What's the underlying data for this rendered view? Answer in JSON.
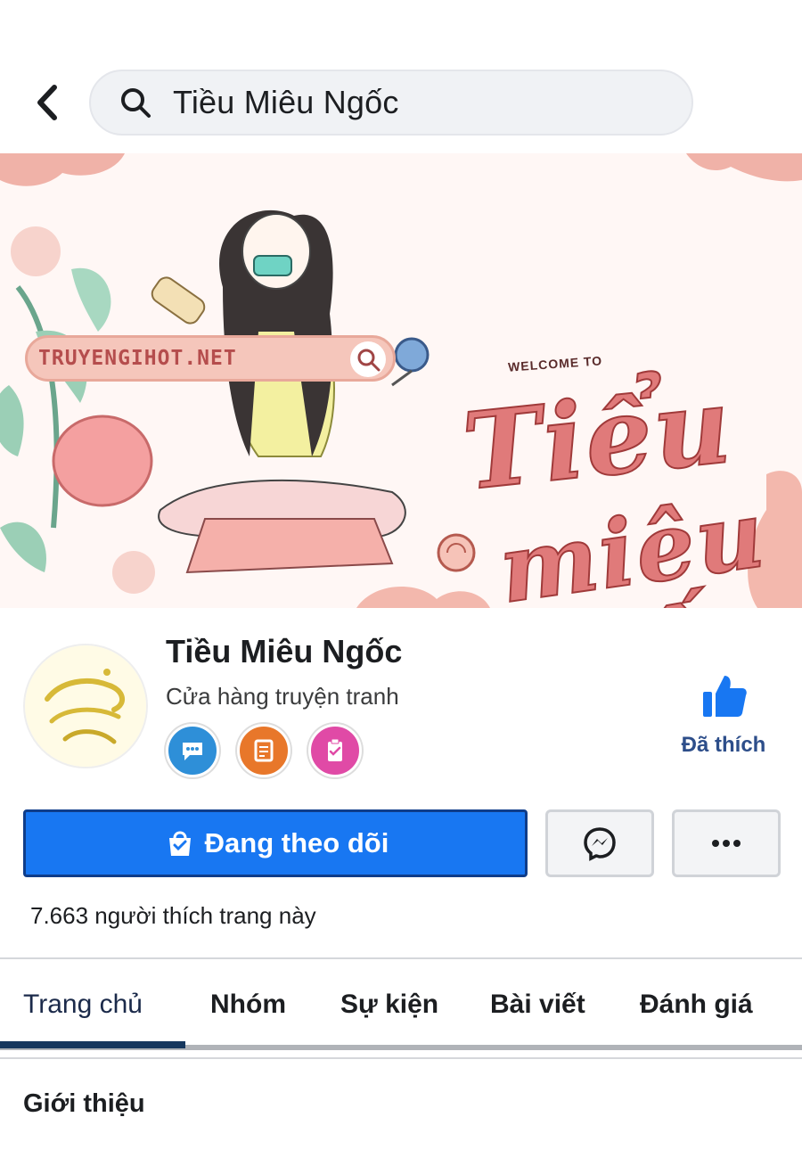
{
  "search": {
    "query": "Tiều Miêu Ngốc"
  },
  "cover": {
    "site_label": "TRUYENGIHOT.NET",
    "welcome_text": "WELCOME TO",
    "script_line1": "Tiểu",
    "script_line2": "miêu",
    "script_line3": "ngốc"
  },
  "profile": {
    "name": "Tiều Miêu Ngốc",
    "category": "Cửa hàng truyện tranh",
    "liked_label": "Đã thích",
    "badges": [
      "chat-badge-icon",
      "document-badge-icon",
      "clipboard-badge-icon"
    ]
  },
  "actions": {
    "follow_label": "Đang theo dõi",
    "more_label": "•••"
  },
  "stats": {
    "likes_text": "7.663 người thích trang này"
  },
  "tabs": [
    {
      "label": "Trang chủ",
      "active": true
    },
    {
      "label": "Nhóm",
      "active": false
    },
    {
      "label": "Sự kiện",
      "active": false
    },
    {
      "label": "Bài viết",
      "active": false
    },
    {
      "label": "Đánh giá",
      "active": false
    }
  ],
  "section": {
    "title": "Giới thiệu"
  },
  "colors": {
    "primary": "#1877f2",
    "primary_border": "#0f3d8a",
    "liked": "#2d4e8a",
    "tab_active": "#16375e"
  }
}
